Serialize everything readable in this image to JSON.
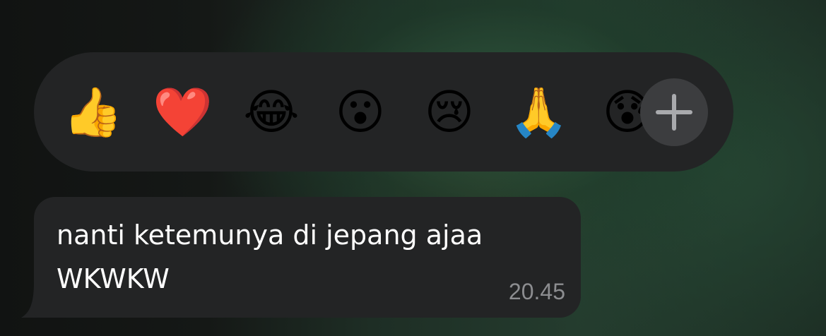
{
  "reactions": {
    "emojis": [
      {
        "char": "👍",
        "name": "thumbs-up"
      },
      {
        "char": "❤️",
        "name": "red-heart"
      },
      {
        "char": "😂",
        "name": "face-with-tears-of-joy"
      },
      {
        "char": "😮",
        "name": "face-with-open-mouth"
      },
      {
        "char": "😢",
        "name": "crying-face"
      },
      {
        "char": "🙏",
        "name": "folded-hands"
      },
      {
        "char": "😰",
        "name": "anxious-face-with-sweat"
      }
    ],
    "more_icon": "plus-icon"
  },
  "message": {
    "lines": [
      "nanti ketemunya di jepang ajaa",
      "WKWKW"
    ],
    "time": "20.45"
  },
  "colors": {
    "bubble": "#232425",
    "reaction_bar": "#232425",
    "plus_button": "#3c3d3f",
    "timestamp": "#8c8d90"
  }
}
